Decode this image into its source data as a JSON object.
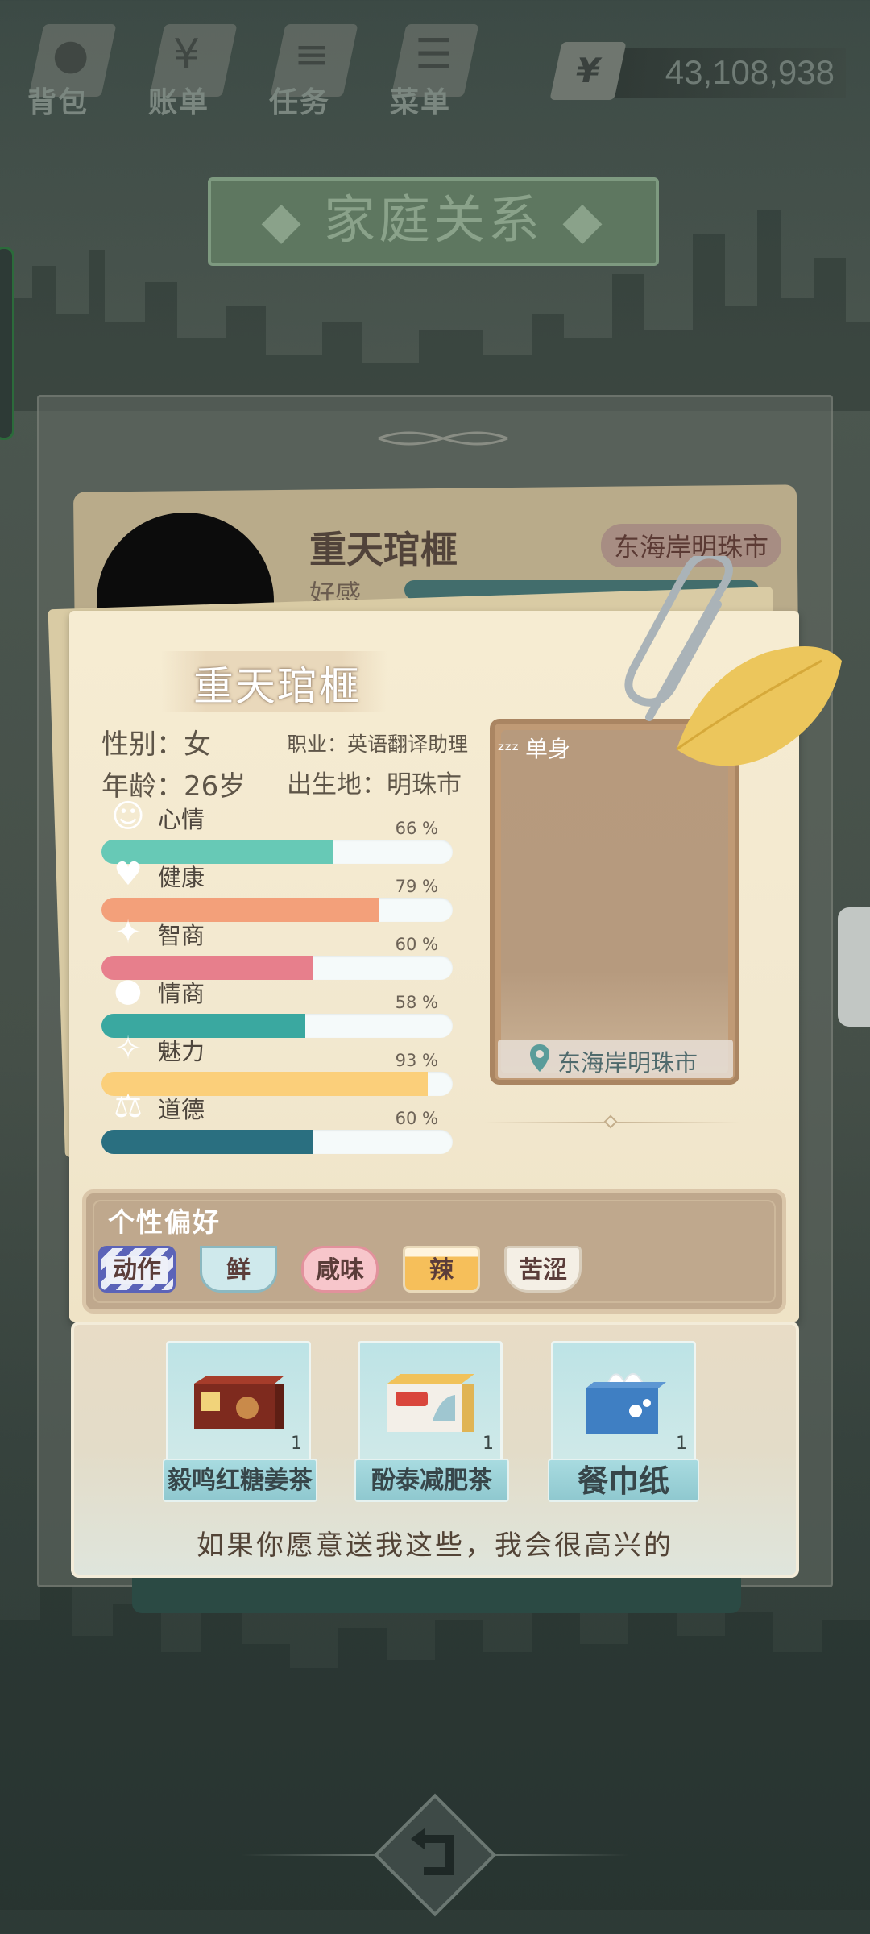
{
  "nav": {
    "items": [
      {
        "label": "背包",
        "icon": "bag-icon"
      },
      {
        "label": "账单",
        "icon": "bill-icon"
      },
      {
        "label": "任务",
        "icon": "task-icon"
      },
      {
        "label": "菜单",
        "icon": "menu-icon"
      }
    ],
    "money": {
      "symbol": "¥",
      "value": "43,108,938"
    }
  },
  "page_title": "◆ 家庭关系 ◆",
  "back_card": {
    "name": "重天琯榧",
    "favor_label": "好感",
    "location": "东海岸明珠市"
  },
  "profile": {
    "name": "重天琯榧",
    "gender_label": "性别：女",
    "occupation_label": "职业：英语翻译助理",
    "age_label": "年龄：26岁",
    "birthplace_label": "出生地：明珠市",
    "status": "单身",
    "status_icon": "sleep-zzz-icon",
    "location": "东海岸明珠市"
  },
  "stats": [
    {
      "name": "心情",
      "value": "66 %",
      "level": 0.66,
      "color": "#67c9b6",
      "icon": "smile-icon"
    },
    {
      "name": "健康",
      "value": "79 %",
      "level": 0.79,
      "color": "#f3a07a",
      "icon": "heart-icon"
    },
    {
      "name": "智商",
      "value": "60 %",
      "level": 0.6,
      "color": "#e77f8c",
      "icon": "lightbulb-icon"
    },
    {
      "name": "情商",
      "value": "58 %",
      "level": 0.58,
      "color": "#3aa8a0",
      "icon": "apple-icon"
    },
    {
      "name": "魅力",
      "value": "93 %",
      "level": 0.93,
      "color": "#fbcf7a",
      "icon": "sparkle-icon"
    },
    {
      "name": "道德",
      "value": "60 %",
      "level": 0.6,
      "color": "#2a6f80",
      "icon": "scale-icon"
    }
  ],
  "preferences": {
    "title": "个性偏好",
    "tags": [
      "动作",
      "鲜",
      "咸味",
      "辣",
      "苦涩"
    ]
  },
  "gifts": [
    {
      "name": "毅鸣红糖姜茶",
      "count": "1",
      "icon": "ginger-tea-box-icon"
    },
    {
      "name": "酚泰减肥茶",
      "count": "1",
      "icon": "diet-tea-box-icon"
    },
    {
      "name": "餐巾纸",
      "count": "1",
      "icon": "tissue-box-icon"
    }
  ],
  "gift_message": "如果你愿意送我这些，我会很高兴的"
}
